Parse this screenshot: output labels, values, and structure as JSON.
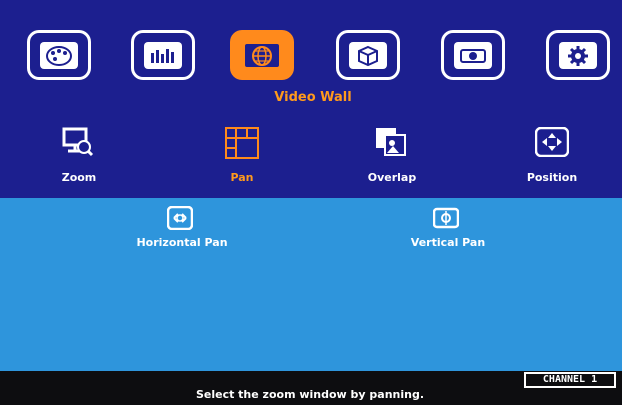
{
  "main_menu": {
    "icons": [
      {
        "name": "color-palette-icon"
      },
      {
        "name": "equalizer-icon"
      },
      {
        "name": "globe-icon",
        "active": true
      },
      {
        "name": "3d-cube-icon"
      },
      {
        "name": "projector-icon"
      },
      {
        "name": "gear-icon"
      }
    ],
    "title": "Video Wall"
  },
  "sub_menu": {
    "items": [
      {
        "label": "Zoom",
        "icon": "zoom-magnifier-icon"
      },
      {
        "label": "Pan",
        "icon": "grid-pan-icon",
        "active": true
      },
      {
        "label": "Overlap",
        "icon": "overlap-images-icon"
      },
      {
        "label": "Position",
        "icon": "position-arrows-icon"
      }
    ]
  },
  "pan_options": [
    {
      "label": "Horizontal Pan",
      "icon": "horizontal-pan-icon"
    },
    {
      "label": "Vertical Pan",
      "icon": "vertical-pan-icon"
    }
  ],
  "status": {
    "hint": "Select the zoom window by panning.",
    "channel": "CHANNEL 1"
  },
  "colors": {
    "top_background": "#1c1f8f",
    "bottom_background": "#2e95dc",
    "accent": "#ff8a1c"
  }
}
